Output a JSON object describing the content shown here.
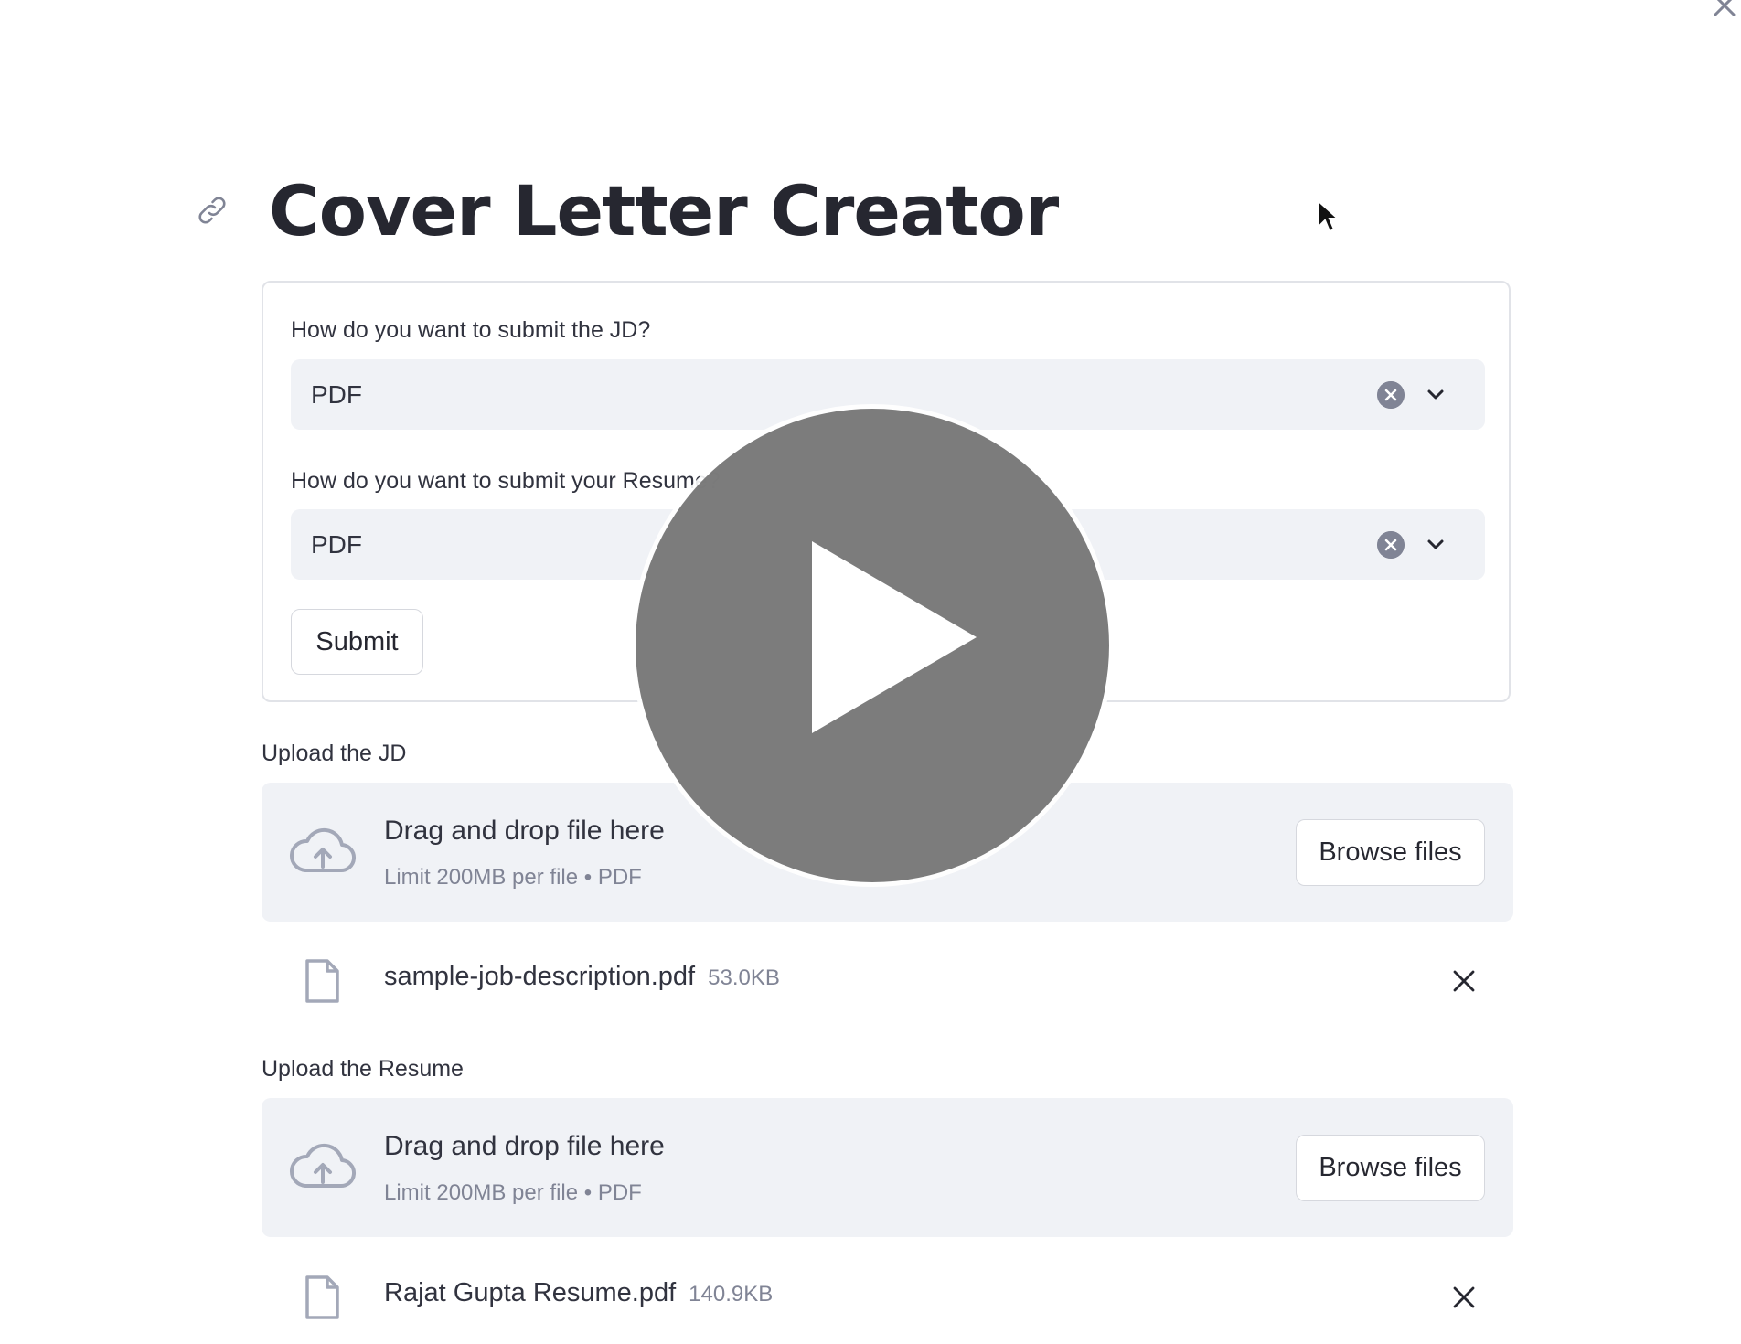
{
  "page": {
    "title": "Cover Letter Creator"
  },
  "form": {
    "jd_question": "How do you want to submit the JD?",
    "jd_selected": "PDF",
    "resume_question": "How do you want to submit your Resume?",
    "resume_selected": "PDF",
    "submit_label": "Submit"
  },
  "upload_jd": {
    "label": "Upload the JD",
    "drop_title": "Drag and drop file here",
    "drop_limit": "Limit 200MB per file • PDF",
    "browse_label": "Browse files",
    "file": {
      "name": "sample-job-description.pdf",
      "size": "53.0KB"
    }
  },
  "upload_resume": {
    "label": "Upload the Resume",
    "drop_title": "Drag and drop file here",
    "drop_limit": "Limit 200MB per file • PDF",
    "browse_label": "Browse files",
    "file": {
      "name": "Rajat Gupta Resume.pdf",
      "size": "140.9KB"
    }
  },
  "icons": {
    "anchor_link": "link-icon",
    "clear": "clear-icon",
    "dropdown": "chevron-down-icon",
    "upload": "cloud-upload-icon",
    "file": "file-icon",
    "remove": "close-icon",
    "play": "play-icon",
    "cursor": "mouse-cursor-icon"
  },
  "colors": {
    "text": "#31333f",
    "title": "#262730",
    "input_bg": "#f0f2f6",
    "muted": "#808495",
    "border": "#e1e3e8",
    "overlay": "#6e6e6e"
  }
}
